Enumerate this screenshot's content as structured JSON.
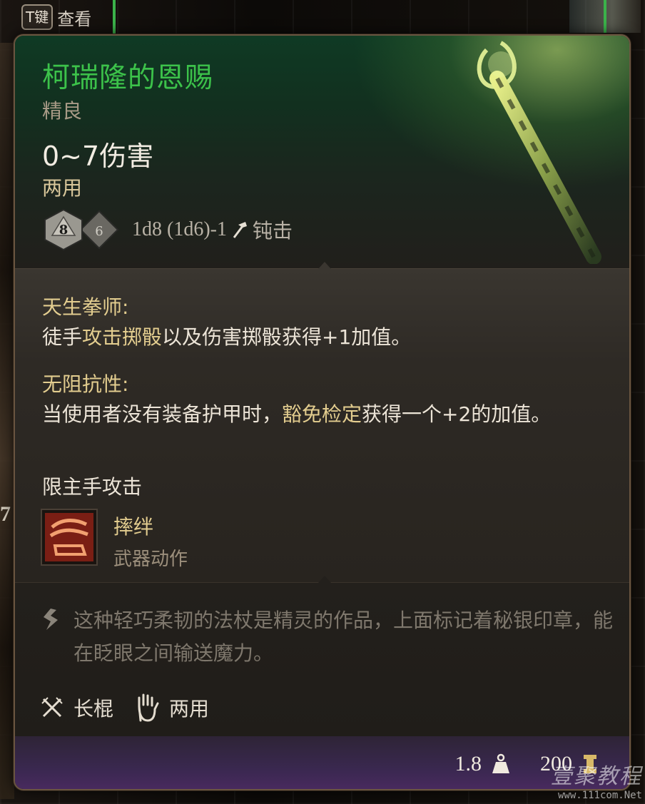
{
  "top_hint": {
    "key": "T键",
    "label": "查看"
  },
  "background_digit": "7",
  "item": {
    "name": "柯瑞隆的恩赐",
    "rarity": "精良",
    "damage": "0~7伤害",
    "hands": "两用",
    "dice": {
      "d1": "8",
      "formula": "1d8 (1d6)-1",
      "damage_type": "钝击"
    }
  },
  "features": [
    {
      "title": "天生拳师:",
      "text_pre": "徒手",
      "text_hl": "攻击掷骰",
      "text_post": "以及伤害掷骰获得+1加值。"
    },
    {
      "title": "无阻抗性:",
      "text_pre": "当使用者没有装备护甲时，",
      "text_hl": "豁免检定",
      "text_post": "获得一个+2的加值。"
    }
  ],
  "main_hand_only": "限主手攻击",
  "action": {
    "name": "摔绊",
    "type": "武器动作"
  },
  "description": "这种轻巧柔韧的法杖是精灵的作品，上面标记着秘银印章，能在眨眼之间输送魔力。",
  "tags": [
    {
      "icon": "crossed-swords-icon",
      "label": "长棍"
    },
    {
      "icon": "hand-icon",
      "label": "两用"
    }
  ],
  "footer": {
    "weight": "1.8",
    "value": "200"
  },
  "watermark": {
    "brand": "壹聚教程",
    "url": "www.111com.Net"
  },
  "colors": {
    "name_green": "#3cc24a",
    "highlight_gold": "#e3cd8f",
    "footer_purple": "#4a2a60"
  }
}
